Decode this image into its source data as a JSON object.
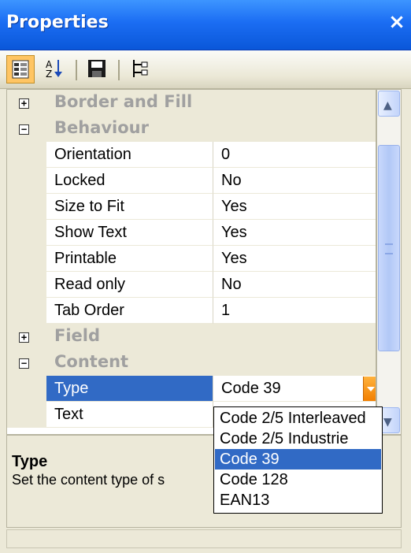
{
  "window": {
    "title": "Properties",
    "close_glyph": "×"
  },
  "toolbar": {
    "buttons": [
      {
        "icon": "categorized-view-icon",
        "active": true
      },
      {
        "icon": "alphabetical-sort-icon",
        "active": false
      },
      {
        "icon": "save-icon",
        "active": false
      },
      {
        "icon": "hierarchy-icon",
        "active": false
      }
    ]
  },
  "grid": {
    "categories": [
      {
        "label": "Border and Fill",
        "expander": "+"
      },
      {
        "label": "Behaviour",
        "expander": "−"
      },
      {
        "label": "Field",
        "expander": "+"
      },
      {
        "label": "Content",
        "expander": "−"
      }
    ],
    "behaviour_props": [
      {
        "name": "Orientation",
        "value": "0"
      },
      {
        "name": "Locked",
        "value": "No"
      },
      {
        "name": "Size to Fit",
        "value": "Yes"
      },
      {
        "name": "Show Text",
        "value": "Yes"
      },
      {
        "name": "Printable",
        "value": "Yes"
      },
      {
        "name": "Read only",
        "value": "No"
      },
      {
        "name": "Tab Order",
        "value": "1"
      }
    ],
    "content_props": [
      {
        "name": "Type",
        "value": "Code 39"
      },
      {
        "name": "Text",
        "value": ""
      }
    ]
  },
  "dropdown": {
    "options": [
      "Code 2/5 Interleaved",
      "Code 2/5 Industrie",
      "Code 39",
      "Code 128",
      "EAN13"
    ],
    "selected": "Code 39"
  },
  "description": {
    "title": "Type",
    "text": "Set the content type of s"
  }
}
